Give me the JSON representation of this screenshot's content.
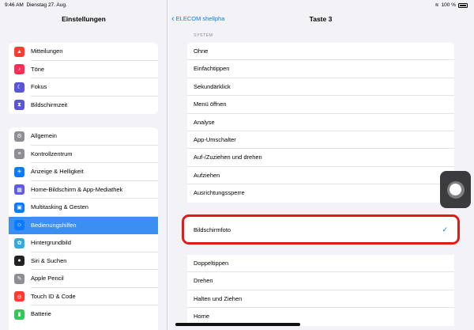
{
  "status_bar": {
    "time": "9:46 AM",
    "date": "Dienstag 27. Aug.",
    "battery": "100 %"
  },
  "sidebar": {
    "title": "Einstellungen",
    "group1": [
      {
        "label": "Mitteilungen",
        "icon": "bell-icon",
        "color": "#ff3b30"
      },
      {
        "label": "Töne",
        "icon": "speaker-icon",
        "color": "#ff2d55"
      },
      {
        "label": "Fokus",
        "icon": "moon-icon",
        "color": "#5856d6"
      },
      {
        "label": "Bildschirmzeit",
        "icon": "hourglass-icon",
        "color": "#5856d6"
      }
    ],
    "group2": [
      {
        "label": "Allgemein",
        "icon": "gear-icon",
        "color": "#8e8e93"
      },
      {
        "label": "Kontrollzentrum",
        "icon": "switches-icon",
        "color": "#8e8e93"
      },
      {
        "label": "Anzeige & Helligkeit",
        "icon": "sun-icon",
        "color": "#0a7aff"
      },
      {
        "label": "Home-Bildschirm & App-Mediathek",
        "icon": "grid-icon",
        "color": "#5e5ce6"
      },
      {
        "label": "Multitasking & Gesten",
        "icon": "multitasking-icon",
        "color": "#0a7aff"
      },
      {
        "label": "Bedienungshilfen",
        "icon": "accessibility-icon",
        "color": "#0a7aff",
        "active": true
      },
      {
        "label": "Hintergrundbild",
        "icon": "flower-icon",
        "color": "#35aadc"
      },
      {
        "label": "Siri & Suchen",
        "icon": "siri-icon",
        "color": "#222222"
      },
      {
        "label": "Apple Pencil",
        "icon": "pencil-icon",
        "color": "#8e8e93"
      },
      {
        "label": "Touch ID & Code",
        "icon": "fingerprint-icon",
        "color": "#ff3b30"
      },
      {
        "label": "Batterie",
        "icon": "battery-icon",
        "color": "#34c759"
      }
    ]
  },
  "nav": {
    "back_label": "ELECOM shellpha",
    "title": "Taste 3"
  },
  "section_header": "SYSTEM",
  "options_top": [
    "Ohne",
    "Einfachtippen",
    "Sekundärklick",
    "Menü öffnen",
    "Analyse",
    "App-Umschalter",
    "Auf-/Zuziehen und drehen",
    "Aufziehen",
    "Ausrichtungssperre"
  ],
  "selected_option": "Bildschirmfoto",
  "options_bottom": [
    "Doppeltippen",
    "Drehen",
    "Halten und Ziehen",
    "Home"
  ],
  "colors": {
    "accent": "#0a7aff",
    "highlight_border": "#e01b1b",
    "active_row": "#3b8ff2"
  }
}
